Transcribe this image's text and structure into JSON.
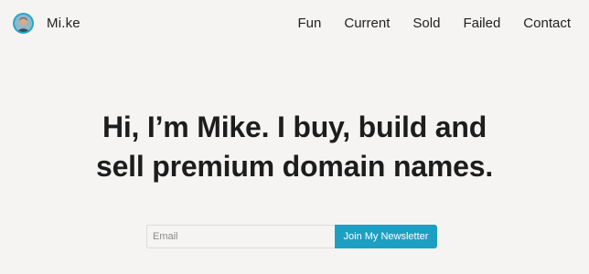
{
  "brand": {
    "name": "Mi.ke",
    "avatar_ring_color": "#25a7cc"
  },
  "nav": {
    "items": [
      {
        "label": "Fun"
      },
      {
        "label": "Current"
      },
      {
        "label": "Sold"
      },
      {
        "label": "Failed"
      },
      {
        "label": "Contact"
      }
    ]
  },
  "hero": {
    "line1": "Hi, I’m Mike. I buy, build and",
    "line2": "sell premium domain names."
  },
  "newsletter": {
    "email_placeholder": "Email",
    "email_value": "",
    "button_label": "Join My Newsletter",
    "button_color": "#1d9fc3"
  }
}
